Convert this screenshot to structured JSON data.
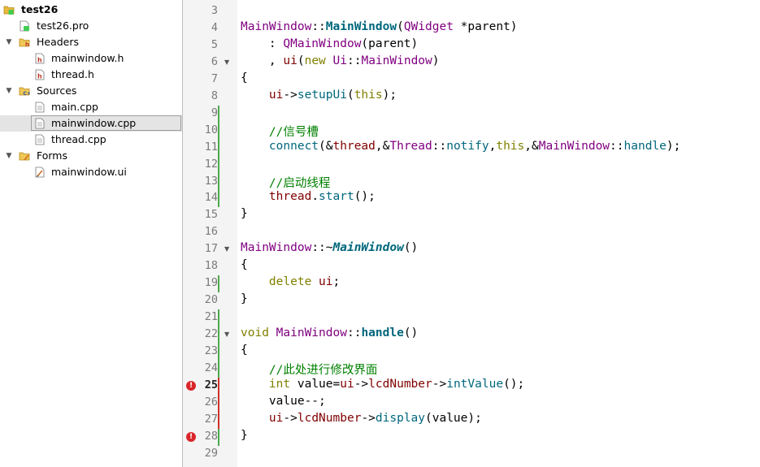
{
  "project_tree": {
    "project": {
      "name": "test26",
      "icon": "qt-project-icon"
    },
    "items": [
      {
        "label": "test26.pro",
        "icon": "pro-file-icon"
      },
      {
        "label": "Headers",
        "icon": "header-folder-icon",
        "expanded": true
      },
      {
        "label": "mainwindow.h",
        "icon": "header-file-icon"
      },
      {
        "label": "thread.h",
        "icon": "header-file-icon"
      },
      {
        "label": "Sources",
        "icon": "source-folder-icon",
        "expanded": true
      },
      {
        "label": "main.cpp",
        "icon": "cpp-file-icon"
      },
      {
        "label": "mainwindow.cpp",
        "icon": "cpp-file-icon",
        "selected": true
      },
      {
        "label": "thread.cpp",
        "icon": "cpp-file-icon"
      },
      {
        "label": "Forms",
        "icon": "forms-folder-icon",
        "expanded": true
      },
      {
        "label": "mainwindow.ui",
        "icon": "ui-file-icon"
      }
    ]
  },
  "editor": {
    "current_line": 25,
    "colors": {
      "class": "#800080",
      "function": "#00677c",
      "keyword": "#808000",
      "member": "#800000",
      "comment": "#008000",
      "error": "#d9262b",
      "modified_saved": "#4ca84c",
      "modified_unsaved": "#d0312d"
    },
    "lines": [
      {
        "n": "3",
        "tokens": []
      },
      {
        "n": "4",
        "tokens": [
          [
            "MainWindow",
            "cls"
          ],
          [
            "::",
            ""
          ],
          [
            "MainWindow",
            "fn b"
          ],
          [
            "(",
            ""
          ],
          [
            "QWidget",
            "cls"
          ],
          [
            " *parent)",
            ""
          ]
        ]
      },
      {
        "n": "5",
        "tokens": [
          [
            "    : ",
            ""
          ],
          [
            "QMainWindow",
            "cls"
          ],
          [
            "(parent)",
            ""
          ]
        ]
      },
      {
        "n": "6",
        "fold": true,
        "tokens": [
          [
            "    , ",
            ""
          ],
          [
            "ui",
            "var"
          ],
          [
            "(",
            ""
          ],
          [
            "new",
            "kw"
          ],
          [
            " ",
            ""
          ],
          [
            "Ui",
            "cls"
          ],
          [
            "::",
            ""
          ],
          [
            "MainWindow",
            "cls"
          ],
          [
            ")",
            ""
          ]
        ]
      },
      {
        "n": "7",
        "tokens": [
          [
            "{",
            ""
          ]
        ]
      },
      {
        "n": "8",
        "tokens": [
          [
            "    ",
            ""
          ],
          [
            "ui",
            "var"
          ],
          [
            "->",
            ""
          ],
          [
            "setupUi",
            "fn"
          ],
          [
            "(",
            ""
          ],
          [
            "this",
            "kw"
          ],
          [
            ");",
            ""
          ]
        ]
      },
      {
        "n": "9",
        "mark": "saved",
        "tokens": []
      },
      {
        "n": "10",
        "mark": "saved",
        "tokens": [
          [
            "    //信号槽",
            "cm"
          ]
        ]
      },
      {
        "n": "11",
        "mark": "saved",
        "tokens": [
          [
            "    ",
            ""
          ],
          [
            "connect",
            "fn"
          ],
          [
            "(&",
            ""
          ],
          [
            "thread",
            "var"
          ],
          [
            ",&",
            ""
          ],
          [
            "Thread",
            "cls"
          ],
          [
            "::",
            ""
          ],
          [
            "notify",
            "fn"
          ],
          [
            ",",
            ""
          ],
          [
            "this",
            "kw"
          ],
          [
            ",&",
            ""
          ],
          [
            "MainWindow",
            "cls"
          ],
          [
            "::",
            ""
          ],
          [
            "handle",
            "fn"
          ],
          [
            ");",
            ""
          ]
        ]
      },
      {
        "n": "12",
        "mark": "saved",
        "tokens": []
      },
      {
        "n": "13",
        "mark": "saved",
        "tokens": [
          [
            "    //启动线程",
            "cm"
          ]
        ]
      },
      {
        "n": "14",
        "mark": "saved",
        "tokens": [
          [
            "    ",
            ""
          ],
          [
            "thread",
            "var"
          ],
          [
            ".",
            ""
          ],
          [
            "start",
            "fn"
          ],
          [
            "();",
            ""
          ]
        ]
      },
      {
        "n": "15",
        "tokens": [
          [
            "}",
            ""
          ]
        ]
      },
      {
        "n": "16",
        "tokens": []
      },
      {
        "n": "17",
        "fold": true,
        "tokens": [
          [
            "MainWindow",
            "cls"
          ],
          [
            "::~",
            ""
          ],
          [
            "MainWindow",
            "fn b i"
          ],
          [
            "()",
            ""
          ]
        ]
      },
      {
        "n": "18",
        "tokens": [
          [
            "{",
            ""
          ]
        ]
      },
      {
        "n": "19",
        "mark": "saved",
        "tokens": [
          [
            "    ",
            ""
          ],
          [
            "delete",
            "kw"
          ],
          [
            " ",
            ""
          ],
          [
            "ui",
            "var"
          ],
          [
            ";",
            ""
          ]
        ]
      },
      {
        "n": "20",
        "tokens": [
          [
            "}",
            ""
          ]
        ]
      },
      {
        "n": "21",
        "mark": "saved",
        "tokens": []
      },
      {
        "n": "22",
        "fold": true,
        "mark": "saved",
        "tokens": [
          [
            "void",
            "kw"
          ],
          [
            " ",
            ""
          ],
          [
            "MainWindow",
            "cls"
          ],
          [
            "::",
            ""
          ],
          [
            "handle",
            "fn b"
          ],
          [
            "()",
            ""
          ]
        ]
      },
      {
        "n": "23",
        "mark": "saved",
        "tokens": [
          [
            "{",
            ""
          ]
        ]
      },
      {
        "n": "24",
        "mark": "saved",
        "tokens": [
          [
            "    //此处进行修改界面",
            "cm"
          ]
        ]
      },
      {
        "n": "25",
        "mark": "unsaved",
        "error": true,
        "tokens": [
          [
            "    ",
            ""
          ],
          [
            "int",
            "kw"
          ],
          [
            " value=",
            ""
          ],
          [
            "ui",
            "var"
          ],
          [
            "->",
            ""
          ],
          [
            "lcdNumber",
            "var"
          ],
          [
            "->",
            ""
          ],
          [
            "intValue",
            "fn"
          ],
          [
            "();",
            ""
          ]
        ]
      },
      {
        "n": "26",
        "mark": "unsaved",
        "tokens": [
          [
            "    value--;",
            ""
          ]
        ]
      },
      {
        "n": "27",
        "mark": "unsaved",
        "tokens": [
          [
            "    ",
            ""
          ],
          [
            "ui",
            "var"
          ],
          [
            "->",
            ""
          ],
          [
            "lcdNumber",
            "var"
          ],
          [
            "->",
            ""
          ],
          [
            "display",
            "fn"
          ],
          [
            "(value);",
            ""
          ]
        ]
      },
      {
        "n": "28",
        "mark": "saved",
        "error": true,
        "tokens": [
          [
            "}",
            ""
          ]
        ]
      },
      {
        "n": "29",
        "tokens": []
      }
    ]
  }
}
